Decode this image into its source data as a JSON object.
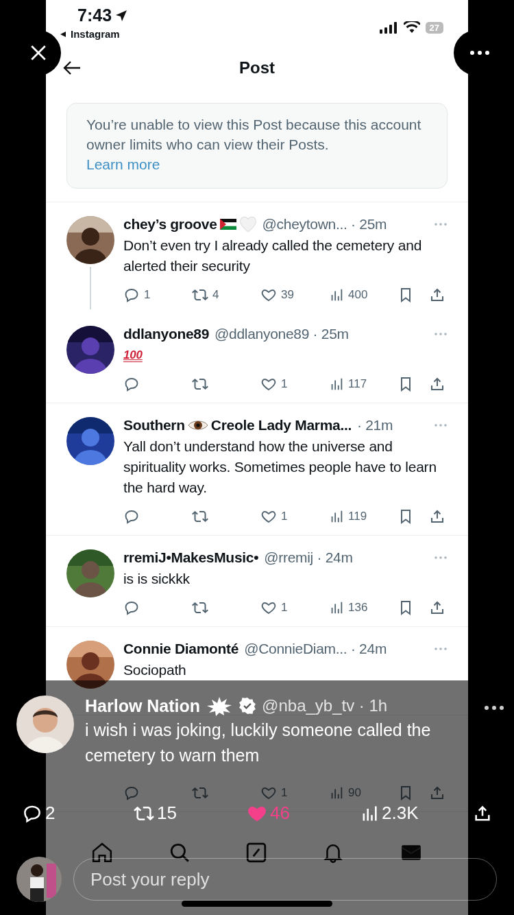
{
  "status_bar": {
    "time": "7:43",
    "back_app": "Instagram",
    "battery": "27"
  },
  "header": {
    "title": "Post"
  },
  "notice": {
    "text": "You’re unable to view this Post because this account owner limits who can view their Posts.",
    "link": "Learn more"
  },
  "replies": [
    {
      "kind": "text",
      "name": [
        {
          "kind": "text",
          "text": "chey’s groove"
        },
        {
          "kind": "flag"
        },
        {
          "kind": "heart"
        }
      ],
      "meta": "@cheytown... · 25m",
      "text": "Don’t even try I already called the cemetery and alerted their security",
      "thread_below": true,
      "actions": {
        "replies": "1",
        "reposts": "4",
        "likes": "39",
        "views": "400"
      }
    },
    {
      "kind": "emoji",
      "name": [
        {
          "kind": "text",
          "text": "ddlanyone89"
        }
      ],
      "meta": "@ddlanyone89 · 25m",
      "text": "100",
      "actions": {
        "likes": "1",
        "views": "117"
      }
    },
    {
      "kind": "text",
      "name": [
        {
          "kind": "text",
          "text": "Southern"
        },
        {
          "kind": "eye"
        },
        {
          "kind": "text",
          "text": "Creole Lady Marma..."
        }
      ],
      "meta": "· 21m",
      "text": "Yall don’t understand how the universe and spirituality works. Sometimes people have to learn the hard way.",
      "actions": {
        "likes": "1",
        "views": "119"
      }
    },
    {
      "kind": "text",
      "name": [
        {
          "kind": "text",
          "text": "rremiJ•MakesMusic•"
        }
      ],
      "meta": "@rremij · 24m",
      "text": "is is sickkk",
      "actions": {
        "likes": "1",
        "views": "136"
      }
    },
    {
      "kind": "text",
      "name": [
        {
          "kind": "text",
          "text": "Connie Diamonté"
        }
      ],
      "meta": "@ConnieDiam... · 24m",
      "text": "Sociopath"
    },
    {
      "actions": {
        "likes": "1",
        "views": "90"
      }
    }
  ],
  "post": {
    "author": "Harlow Nation",
    "handle": "@nba_yb_tv · 1h",
    "text": "i wish i was joking, luckily someone called the cemetery to warn them",
    "stats": {
      "replies": "2",
      "reposts": "15",
      "likes": "46",
      "views": "2.3K",
      "liked": true
    }
  },
  "reply_field": {
    "placeholder": "Post your reply"
  }
}
